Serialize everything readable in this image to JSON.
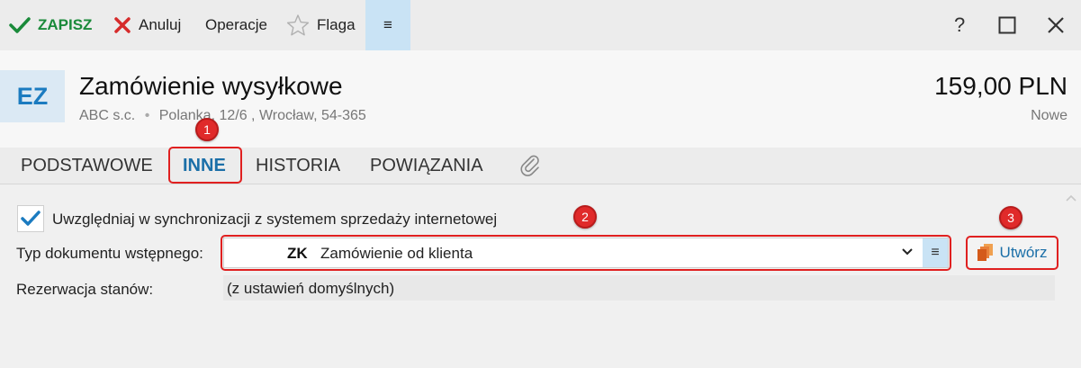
{
  "toolbar": {
    "save_label": "ZAPISZ",
    "cancel_label": "Anuluj",
    "operations_label": "Operacje",
    "flag_label": "Flaga",
    "menu_glyph": "≡",
    "help_glyph": "?",
    "colors": {
      "save": "#1a8a3a",
      "cancel": "#d62b2b",
      "menu_bg": "#c9e3f5"
    }
  },
  "header": {
    "doc_type_code": "EZ",
    "title": "Zamówienie wysyłkowe",
    "company": "ABC s.c.",
    "separator": "•",
    "address": "Polanka, 12/6 , Wrocław, 54-365",
    "amount": "159,00 PLN",
    "status": "Nowe"
  },
  "tabs": [
    {
      "label": "PODSTAWOWE",
      "active": false
    },
    {
      "label": "INNE",
      "active": true
    },
    {
      "label": "HISTORIA",
      "active": false
    },
    {
      "label": "POWIĄZANIA",
      "active": false
    }
  ],
  "form": {
    "sync_checkbox": {
      "label": "Uwzględniaj w synchronizacji z systemem sprzedaży internetowej",
      "checked": true
    },
    "doc_type": {
      "label": "Typ dokumentu wstępnego:",
      "code": "ZK",
      "value": "Zamówienie od klienta",
      "menu_glyph": "≡"
    },
    "create_button_label": "Utwórz",
    "reservation": {
      "label": "Rezerwacja stanów:",
      "value": "(z ustawień domyślnych)"
    }
  },
  "annotations": [
    {
      "number": "1"
    },
    {
      "number": "2"
    },
    {
      "number": "3"
    }
  ],
  "icons": [
    "check-icon",
    "close-icon",
    "star-icon",
    "menu-icon",
    "help-icon",
    "maximize-icon",
    "attachment-icon",
    "chevron-down-icon",
    "copy-icon",
    "chevron-up-icon"
  ],
  "accent_color": "#1b6fa8"
}
